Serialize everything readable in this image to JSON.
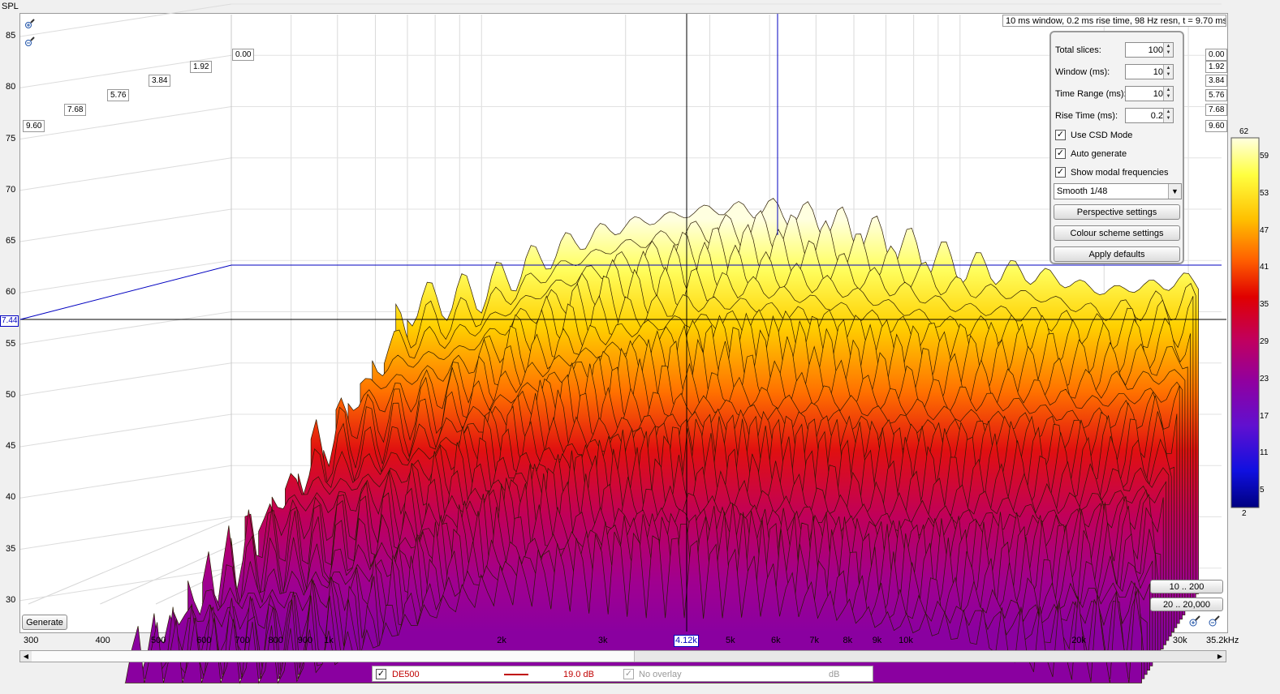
{
  "chart_data": {
    "type": "waterfall",
    "ylabel": "SPL",
    "y_ticks": [
      85,
      80,
      75,
      70,
      65,
      60,
      55,
      50,
      45,
      40,
      35,
      30
    ],
    "x_ticks": [
      "300",
      "400",
      "500",
      "600",
      "700",
      "800",
      "900",
      "1k",
      "2k",
      "3k",
      "5k",
      "6k",
      "7k",
      "8k",
      "9k",
      "10k",
      "20k",
      "30k",
      "35.2kHz"
    ],
    "x_range_hz": [
      300,
      35200
    ],
    "y_range_db": [
      27,
      87
    ],
    "log_x": true,
    "grid": true,
    "time_labels": [
      "0.00",
      "1.92",
      "3.84",
      "5.76",
      "7.68",
      "9.60"
    ],
    "time_range_ms": [
      0,
      9.6
    ],
    "cursor_freq": "4.12k",
    "cursor_spl": "7.44",
    "info": "10 ms window, 0.2 ms rise time,  98 Hz resn, t = 9.70 ms",
    "series_front_peaks": [
      {
        "freq": 700,
        "spl": 55.5
      },
      {
        "freq": 1000,
        "spl": 57
      },
      {
        "freq": 1300,
        "spl": 60
      },
      {
        "freq": 1600,
        "spl": 62
      },
      {
        "freq": 2000,
        "spl": 63.5
      },
      {
        "freq": 3000,
        "spl": 65
      },
      {
        "freq": 4000,
        "spl": 65
      },
      {
        "freq": 5000,
        "spl": 64
      },
      {
        "freq": 6000,
        "spl": 63
      },
      {
        "freq": 8000,
        "spl": 61
      },
      {
        "freq": 10000,
        "spl": 59.5
      },
      {
        "freq": 15000,
        "spl": 58.5
      },
      {
        "freq": 20000,
        "spl": 57
      },
      {
        "freq": 30000,
        "spl": 58
      }
    ],
    "colour_scale": {
      "max": "62",
      "min": "2",
      "ticks": [
        "59",
        "53",
        "47",
        "41",
        "35",
        "29",
        "23",
        "17",
        "11",
        "5"
      ],
      "colors": [
        "#ffffd0",
        "#ffff40",
        "#ffc000",
        "#ff6000",
        "#e00000",
        "#c00060",
        "#9000a0",
        "#6010d0",
        "#1010e0",
        "#000080"
      ]
    }
  },
  "panel": {
    "total_slices": {
      "label": "Total slices:",
      "value": "100"
    },
    "window": {
      "label": "Window (ms):",
      "value": "10"
    },
    "time_range": {
      "label": "Time Range (ms):",
      "value": "10"
    },
    "rise_time": {
      "label": "Rise Time (ms):",
      "value": "0.2"
    },
    "use_csd": "Use CSD Mode",
    "auto_generate": "Auto generate",
    "show_modal": "Show modal frequencies",
    "smoothing": "Smooth 1/48",
    "perspective": "Perspective settings",
    "colour_scheme": "Colour scheme settings",
    "apply_defaults": "Apply defaults"
  },
  "range_buttons": [
    "10 .. 200",
    "20 .. 20,000"
  ],
  "generate": "Generate",
  "legend": {
    "name": "DE500",
    "value": "19.0 dB",
    "overlay": "No overlay",
    "overlay_unit": "dB",
    "trace_color": "#c00000"
  }
}
